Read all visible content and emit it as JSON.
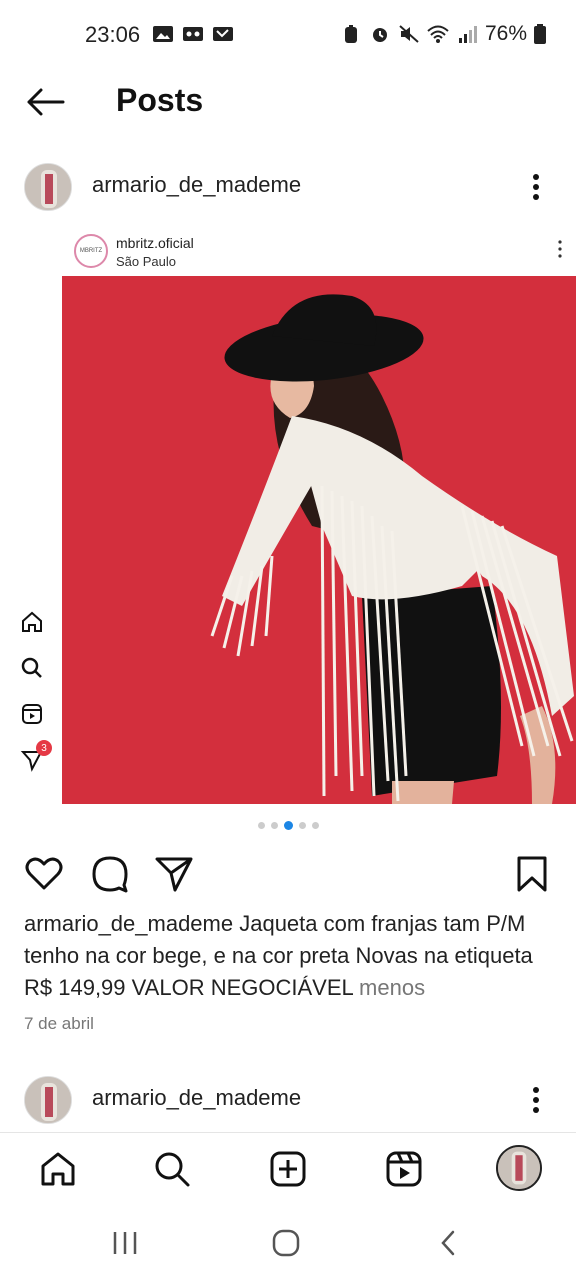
{
  "status_bar": {
    "time": "23:06",
    "battery": "76%",
    "icons_left": [
      "image-icon",
      "voicemail-icon",
      "missed-call-icon"
    ],
    "icons_right": [
      "battery-saver-icon",
      "alarm-icon",
      "mute-icon",
      "wifi-icon",
      "signal-icon",
      "battery-icon"
    ]
  },
  "header": {
    "title": "Posts"
  },
  "post": {
    "username": "armario_de_mademe",
    "shared_post": {
      "username": "mbritz.oficial",
      "location": "São Paulo",
      "logo_text": "MBRITZ"
    },
    "carousel": {
      "count": 5,
      "active_index": 2
    },
    "caption_user": "armario_de_mademe",
    "caption_text": " Jaqueta com franjas tam P/M tenho na cor bege, e na cor preta Novas na etiqueta R$ 149,99 VALOR NEGOCIÁVEL ",
    "less_label": "menos",
    "date": "7 de abril",
    "side_nav_badge": "3"
  },
  "next_post": {
    "username": "armario_de_mademe"
  },
  "colors": {
    "photo_background": "#d9303f",
    "accent_blue": "#1c86e5",
    "badge_red": "#e53945"
  }
}
